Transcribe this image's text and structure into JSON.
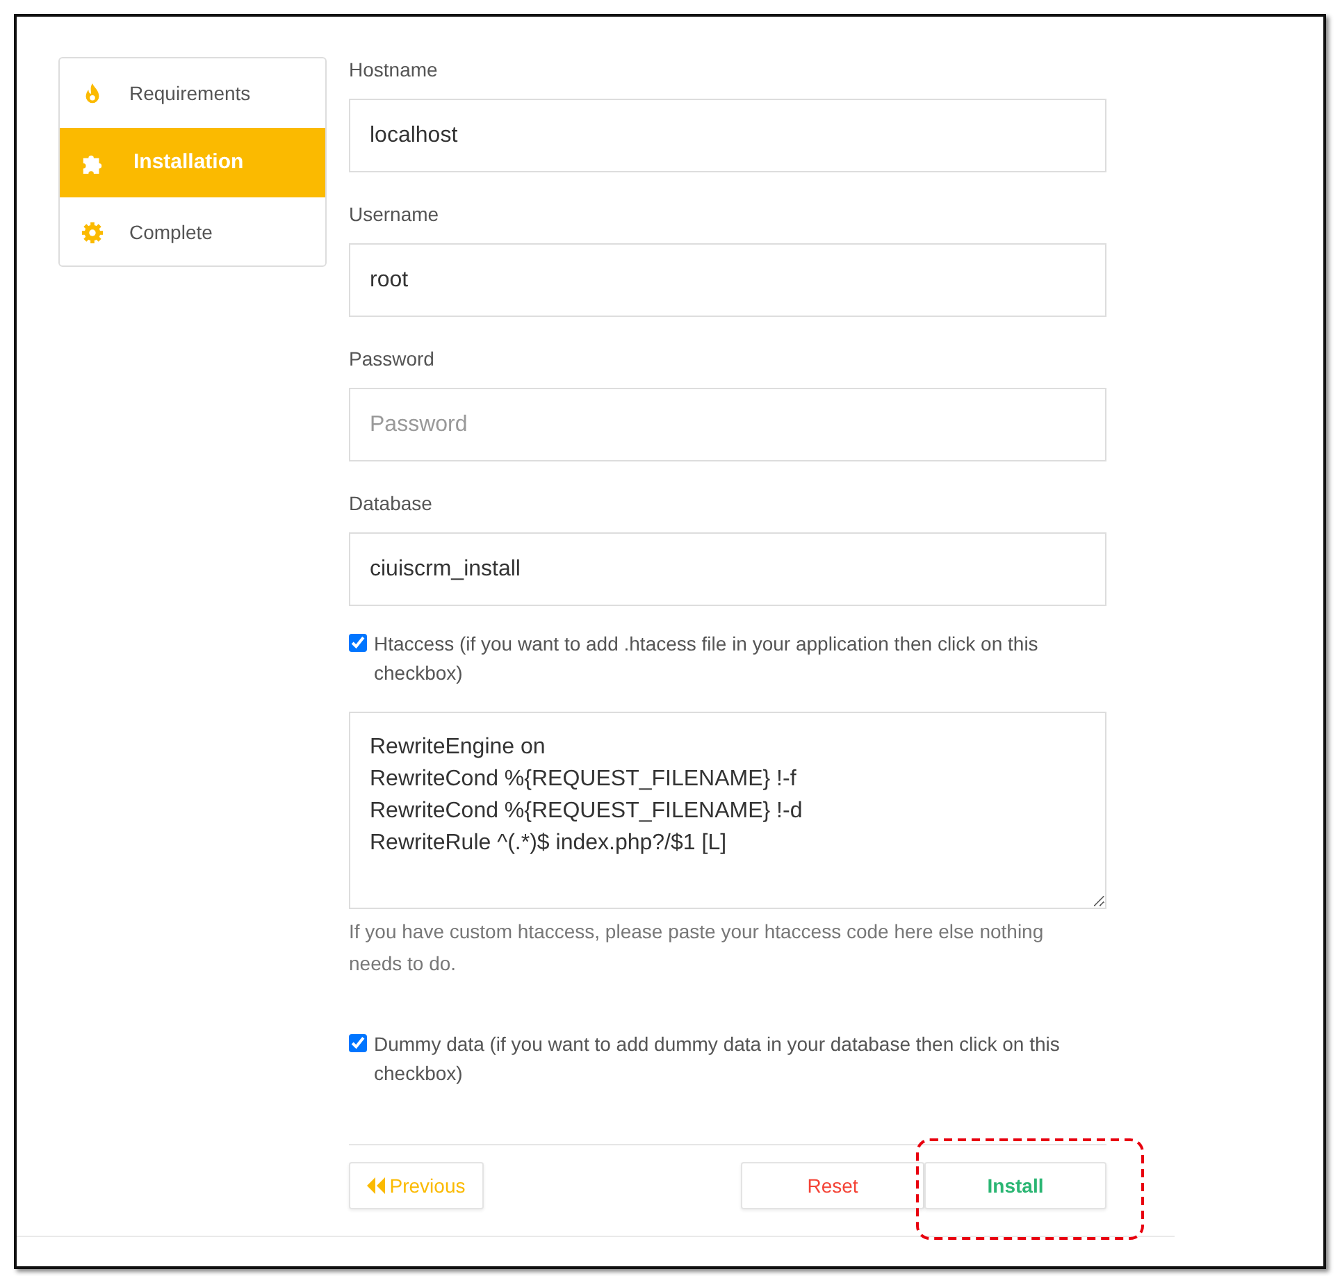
{
  "steps": [
    {
      "label": "Requirements",
      "kind": "flame",
      "selected": false
    },
    {
      "label": "Installation",
      "kind": "puzzle",
      "selected": true
    },
    {
      "label": "Complete",
      "kind": "gear",
      "selected": false
    }
  ],
  "fields": [
    {
      "label": "Hostname",
      "value": "localhost"
    },
    {
      "label": "Username",
      "value": "root"
    },
    {
      "label": "Password",
      "placeholder": "Password"
    },
    {
      "label": "Database",
      "value": "ciuiscrm_install"
    }
  ],
  "htaccess": {
    "checked": true,
    "label": "Htaccess (if you want to add .htacess file in your application then click on this checkbox)",
    "code": [
      "RewriteEngine on",
      "RewriteCond %{REQUEST_FILENAME} !-f",
      "RewriteCond %{REQUEST_FILENAME} !-d",
      "RewriteRule ^(.*)$ index.php?/$1 [L]"
    ],
    "help": "If you have custom htaccess, please paste your htaccess code here else nothing needs to do."
  },
  "dummy": {
    "checked": true,
    "label": "Dummy data (if you want to add dummy data in your database then click on this checkbox)"
  },
  "buttons": {
    "previous": "Previous",
    "reset": "Reset",
    "install": "Install",
    "install_highlighted": true
  }
}
